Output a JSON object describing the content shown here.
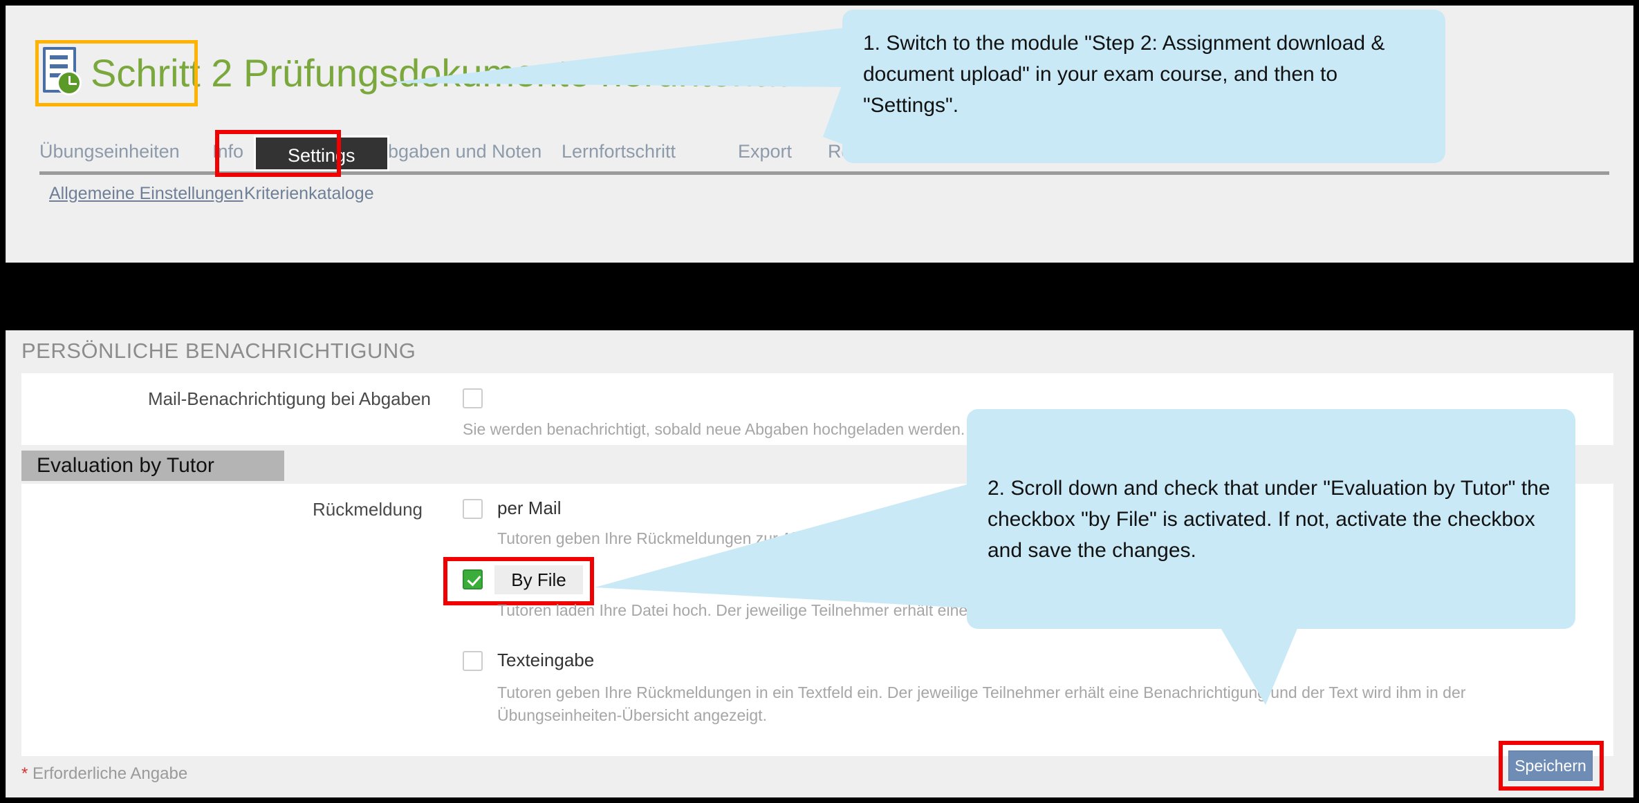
{
  "header": {
    "title_step": "Schritt 2",
    "title_rest": "Prüfungsdokumente herunterladen & Dokumente hochladen",
    "icon_name": "document-clock-icon"
  },
  "tabs": [
    {
      "label": "Übungseinheiten",
      "active": false
    },
    {
      "label": "Info",
      "active": false
    },
    {
      "label": "Settings",
      "active": true
    },
    {
      "label": "Abgaben und Noten",
      "active": false
    },
    {
      "label": "Lernfortschritt",
      "active": false
    },
    {
      "label": "Export",
      "active": false
    },
    {
      "label": "Rechte",
      "active": false
    }
  ],
  "subtabs": [
    {
      "label": "Allgemeine Einstellungen",
      "active": true
    },
    {
      "label": "Kriterienkataloge",
      "active": false
    }
  ],
  "form": {
    "section_title": "PERSÖNLICHE BENACHRICHTIGUNG",
    "mail_notification": {
      "label": "Mail-Benachrichtigung bei Abgaben",
      "checked": false,
      "hint": "Sie werden benachrichtigt, sobald neue Abgaben hochgeladen werden."
    },
    "evaluation_section_label": "Evaluation by Tutor",
    "feedback": {
      "label": "Rückmeldung",
      "options": [
        {
          "label": "per Mail",
          "checked": false,
          "hint": "Tutoren geben Ihre Rückmeldungen zur Abgabe in ein Textfeld ein."
        },
        {
          "label": "By File",
          "checked": true,
          "hint": "Tutoren laden Ihre Datei hoch. Der jeweilige Teilnehmer erhält eine Benachrichtigung."
        },
        {
          "label": "Texteingabe",
          "checked": false,
          "hint": "Tutoren geben Ihre Rückmeldungen in ein Textfeld ein. Der jeweilige Teilnehmer erhält eine Benachrichtigung und der Text wird ihm in der Übungseinheiten-Übersicht angezeigt."
        }
      ]
    },
    "required_star": "*",
    "required_note": "Erforderliche Angabe",
    "save_label": "Speichern"
  },
  "callouts": [
    {
      "id": "callout-1",
      "text": "1. Switch to the module \"Step 2: Assignment download & document upload\" in your exam course, and then to \"Settings\"."
    },
    {
      "id": "callout-2",
      "text": "2. Scroll down and check that under \"Evaluation by Tutor\" the checkbox \"by File\" is activated. If not, activate the checkbox and save the changes."
    }
  ],
  "colors": {
    "callout_bg": "#c9e9f6",
    "highlight_red": "#f00000",
    "highlight_orange": "#ffb300",
    "title_green": "#7aa83c",
    "checked_green": "#3aad3a",
    "save_blue": "#6f8cb5"
  }
}
